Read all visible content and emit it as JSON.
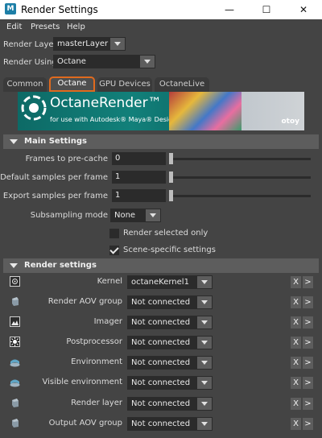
{
  "window": {
    "app_icon": "M",
    "title": "Render Settings",
    "controls": {
      "minimize": "—",
      "maximize": "☐",
      "close": "✕"
    }
  },
  "menu": [
    "Edit",
    "Presets",
    "Help"
  ],
  "render_layer": {
    "label": "Render Layer",
    "value": "masterLayer"
  },
  "render_using": {
    "label": "Render Using",
    "value": "Octane"
  },
  "tabs": [
    {
      "label": "Common",
      "active": false
    },
    {
      "label": "Octane",
      "active": true
    },
    {
      "label": "GPU Devices",
      "active": false
    },
    {
      "label": "OctaneLive",
      "active": false
    }
  ],
  "banner": {
    "title": "OctaneRender™",
    "subtitle": "for use with Autodesk® Maya® Design Software",
    "brand": "otoy"
  },
  "main_settings": {
    "header": "Main Settings",
    "frames_to_precache": {
      "label": "Frames to pre-cache",
      "value": "0",
      "slider": 0.0
    },
    "default_samples": {
      "label": "Default samples per frame",
      "value": "1",
      "slider": 0.0
    },
    "export_samples": {
      "label": "Export samples per frame",
      "value": "1",
      "slider": 0.0
    },
    "subsampling": {
      "label": "Subsampling mode",
      "value": "None"
    },
    "render_selected_only": {
      "label": "Render selected only",
      "checked": false
    },
    "scene_specific": {
      "label": "Scene-specific settings",
      "checked": true
    }
  },
  "render_settings": {
    "header": "Render settings",
    "x_label": "X",
    "arrow_label": ">",
    "rows": [
      {
        "label": "Kernel",
        "value": "octaneKernel1",
        "icon": "kernel-icon"
      },
      {
        "label": "Render AOV group",
        "value": "Not connected",
        "icon": "aov-group-icon"
      },
      {
        "label": "Imager",
        "value": "Not connected",
        "icon": "imager-icon"
      },
      {
        "label": "Postprocessor",
        "value": "Not connected",
        "icon": "postprocessor-icon"
      },
      {
        "label": "Environment",
        "value": "Not connected",
        "icon": "environment-icon"
      },
      {
        "label": "Visible environment",
        "value": "Not connected",
        "icon": "visible-environment-icon"
      },
      {
        "label": "Render layer",
        "value": "Not connected",
        "icon": "render-layer-icon"
      },
      {
        "label": "Output AOV group",
        "value": "Not connected",
        "icon": "output-aov-icon"
      }
    ]
  },
  "colors": {
    "accent": "#e06a1e",
    "panel": "#444444",
    "field": "#2b2b2b",
    "section": "#5d5d5d"
  }
}
